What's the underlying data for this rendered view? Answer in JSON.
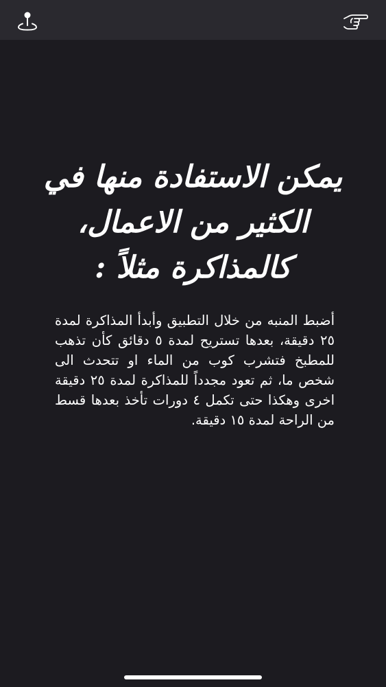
{
  "top_bar": {
    "left_icon": "map-pin-icon",
    "right_icon": "pointing-hand-icon"
  },
  "headline": "يمكن الاستفادة منها في الكثير من الاعمال، كالمذاكرة مثلاً :",
  "body": "أضبط المنبه من خلال التطبيق وأبدأ المذاكرة لمدة ٢٥ دقيقة، بعدها تستريح لمدة ٥ دقائق كأن تذهب للمطبخ فتشرب كوب من الماء او تتحدث الى شخص ما، ثم تعود مجدداً للمذاكرة لمدة ٢٥ دقيقة اخرى وهكذا حتى تكمل ٤ دورات تأخذ بعدها قسط من الراحة لمدة ١٥ دقيقة.",
  "colors": {
    "background": "#1c1b20",
    "top_bar": "#2a292f",
    "text": "#ffffff"
  }
}
